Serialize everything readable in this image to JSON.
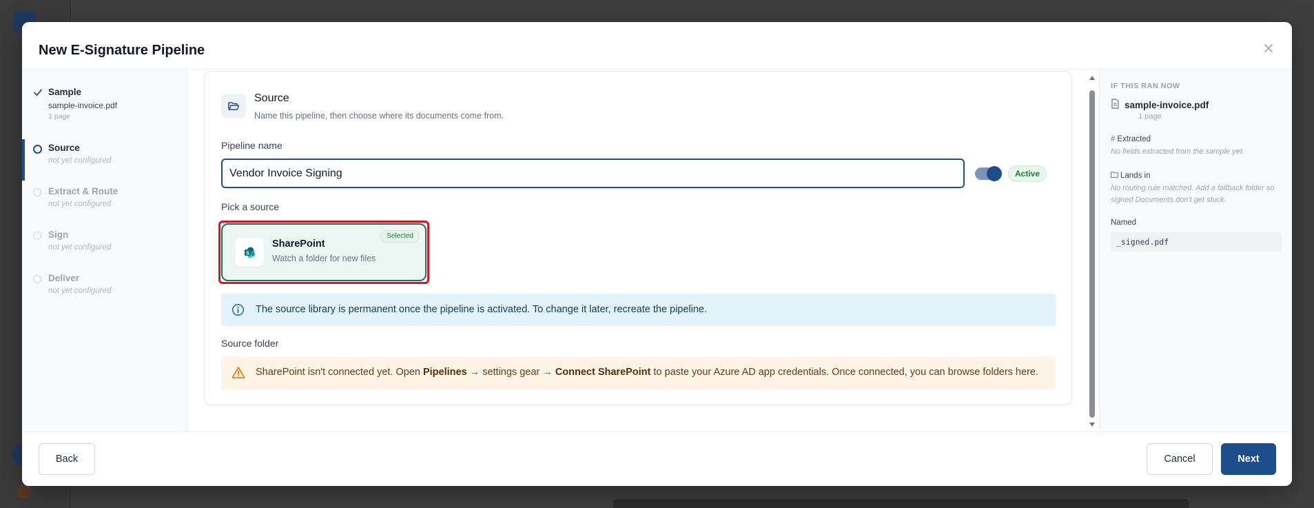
{
  "dialog": {
    "title": "New E-Signature Pipeline",
    "close_icon": "close-icon"
  },
  "steps": [
    {
      "name": "Sample",
      "detail": "sample-invoice.pdf",
      "meta": "1 page",
      "state": "done"
    },
    {
      "name": "Source",
      "detail": "not yet configured",
      "state": "current"
    },
    {
      "name": "Extract & Route",
      "detail": "not yet configured",
      "state": "pending"
    },
    {
      "name": "Sign",
      "detail": "not yet configured",
      "state": "pending"
    },
    {
      "name": "Deliver",
      "detail": "not yet configured",
      "state": "pending"
    }
  ],
  "source": {
    "title": "Source",
    "description": "Name this pipeline, then choose where its documents come from.",
    "pipeline_name_label": "Pipeline name",
    "pipeline_name_value": "Vendor Invoice Signing",
    "active_toggle_on": true,
    "active_badge": "Active",
    "pick_source_label": "Pick a source",
    "option": {
      "name": "SharePoint",
      "description": "Watch a folder for new files",
      "badge": "Selected"
    },
    "info_message": "The source library is permanent once the pipeline is activated. To change it later, recreate the pipeline.",
    "source_folder_label": "Source folder",
    "warning": {
      "part1": "SharePoint isn't connected yet. Open ",
      "link1": "Pipelines",
      "part2": " → settings gear → ",
      "link2": "Connect SharePoint",
      "part3": " to paste your Azure AD app credentials. Once connected, you can browse folders here."
    }
  },
  "preview": {
    "caption": "IF THIS RAN NOW",
    "file": "sample-invoice.pdf",
    "pages": "1 page",
    "extracted_label": "Extracted",
    "extracted_note": "No fields extracted from the sample yet.",
    "lands_in_label": "Lands in",
    "lands_in_note": "No routing rule matched. Add a fallback folder so signed Documents don't get stuck.",
    "named_label": "Named",
    "named_value": "_signed.pdf"
  },
  "footer": {
    "back": "Back",
    "cancel": "Cancel",
    "next": "Next"
  },
  "colors": {
    "primary": "#1e4d8c",
    "selected_border": "#1f6f66",
    "highlight_outline": "#e0121b",
    "info_bg": "#e3f3fa",
    "warning_bg": "#fdf3e6"
  }
}
